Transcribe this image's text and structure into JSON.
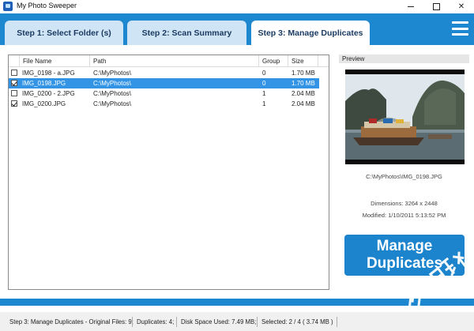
{
  "window": {
    "title": "My Photo Sweeper",
    "controls": [
      "minimize",
      "maximize",
      "close"
    ],
    "close_glyph": "✕"
  },
  "tabs": [
    {
      "label": "Step 1: Select Folder (s)",
      "active": false
    },
    {
      "label": "Step 2: Scan Summary",
      "active": false
    },
    {
      "label": "Step 3: Manage Duplicates",
      "active": true
    }
  ],
  "menu_icon": "hamburger-icon",
  "file_list": {
    "columns": [
      "File Name",
      "Path",
      "Group",
      "Size"
    ],
    "rows": [
      {
        "checked": false,
        "selected": false,
        "name": "IMG_0198 - a.JPG",
        "path": "C:\\MyPhotos\\",
        "group": "0",
        "size": "1.70 MB"
      },
      {
        "checked": true,
        "selected": true,
        "name": "IMG_0198.JPG",
        "path": "C:\\MyPhotos\\",
        "group": "0",
        "size": "1.70 MB"
      },
      {
        "checked": false,
        "selected": false,
        "name": "IMG_0200 - 2.JPG",
        "path": "C:\\MyPhotos\\",
        "group": "1",
        "size": "2.04 MB"
      },
      {
        "checked": true,
        "selected": false,
        "name": "IMG_0200.JPG",
        "path": "C:\\MyPhotos\\",
        "group": "1",
        "size": "2.04 MB"
      }
    ]
  },
  "preview": {
    "header": "Preview",
    "path": "C:\\MyPhotos\\IMG_0198.JPG",
    "dimensions": "Dimensions: 3264 x 2448",
    "modified": "Modified: 1/10/2011 5:13:52 PM"
  },
  "manage_button": {
    "line1": "Manage",
    "line2": "Duplicates"
  },
  "status": {
    "step": "Step 3: Manage Duplicates - Original Files: 9;",
    "duplicates": "Duplicates: 4;",
    "disk_space": "Disk Space Used: 7.49 MB;",
    "selected": "Selected: 2 / 4    ( 3.74 MB )"
  },
  "watermark": {
    "text": "海绵软件",
    "color": "#ffffff"
  },
  "colors": {
    "accent": "#1d88d0",
    "selection": "#3394e6",
    "tab_inactive": "#cfe4f4",
    "tab_text": "#1b3b63"
  }
}
